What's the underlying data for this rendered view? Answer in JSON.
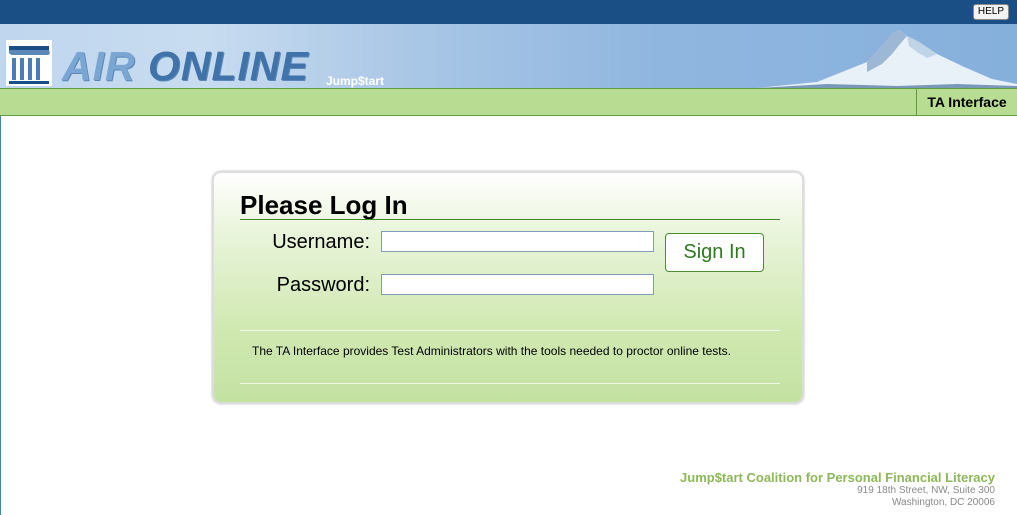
{
  "topbar": {
    "help_label": "HELP"
  },
  "banner": {
    "logo_word1": "AIR ",
    "logo_word2": "ONLINE",
    "tagline": "Jump$tart"
  },
  "nav": {
    "interface_label": "TA Interface"
  },
  "login": {
    "title": "Please Log In",
    "username_label": "Username:",
    "password_label": "Password:",
    "username_value": "",
    "password_value": "",
    "signin_label": "Sign In",
    "description": "The TA Interface provides Test Administrators with the tools needed to proctor online tests."
  },
  "footer": {
    "org_name": "Jump$tart Coalition for Personal Financial Literacy",
    "address_line1": "919 18th Street, NW, Suite 300",
    "address_line2": "Washington, DC 20006"
  },
  "colors": {
    "topbar": "#1a4f86",
    "nav_green": "#b8dc92",
    "accent_green": "#2d7a1e",
    "footer_green": "#8db85a"
  },
  "icons": {
    "logo": "building-columns-logo",
    "banner_image": "snowy-mountain"
  }
}
